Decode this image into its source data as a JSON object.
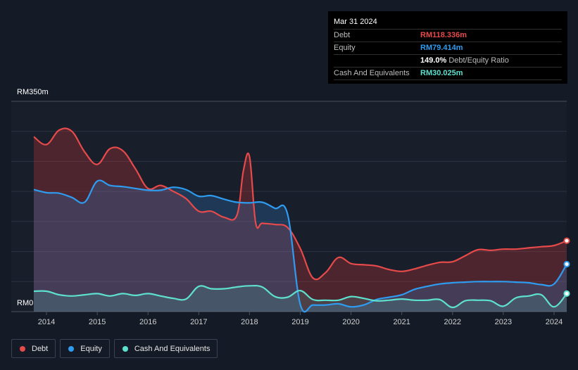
{
  "tooltip": {
    "date": "Mar 31 2024",
    "rows": [
      {
        "label": "Debt",
        "value": "RM118.336m",
        "color": "#e64a4a",
        "suffix": ""
      },
      {
        "label": "Equity",
        "value": "RM79.414m",
        "color": "#2e9cf0",
        "suffix": ""
      },
      {
        "label": "",
        "value": "149.0%",
        "color": "#ffffff",
        "suffix": "Debt/Equity Ratio"
      },
      {
        "label": "Cash And Equivalents",
        "value": "RM30.025m",
        "color": "#5ee0cf",
        "suffix": ""
      }
    ]
  },
  "legend": [
    {
      "label": "Debt",
      "color": "#e64a4a"
    },
    {
      "label": "Equity",
      "color": "#2e9cf0"
    },
    {
      "label": "Cash And Equivalents",
      "color": "#5ee0cf"
    }
  ],
  "chart_data": {
    "type": "area",
    "y_top_label": "RM350m",
    "y_bottom_label": "RM0",
    "ylim": [
      0,
      350
    ],
    "xlim": [
      2013.75,
      2024.25
    ],
    "x_ticks": [
      "2014",
      "2015",
      "2016",
      "2017",
      "2018",
      "2019",
      "2020",
      "2021",
      "2022",
      "2023",
      "2024"
    ],
    "grid": true,
    "series": [
      {
        "name": "Debt",
        "color": "#e64a4a",
        "x": [
          2013.75,
          2014.0,
          2014.25,
          2014.5,
          2014.75,
          2015.0,
          2015.25,
          2015.5,
          2015.75,
          2016.0,
          2016.25,
          2016.5,
          2016.75,
          2017.0,
          2017.25,
          2017.5,
          2017.75,
          2017.88,
          2018.0,
          2018.12,
          2018.25,
          2018.5,
          2018.75,
          2019.0,
          2019.25,
          2019.5,
          2019.75,
          2020.0,
          2020.25,
          2020.5,
          2020.75,
          2021.0,
          2021.25,
          2021.5,
          2021.75,
          2022.0,
          2022.25,
          2022.5,
          2022.75,
          2023.0,
          2023.25,
          2023.5,
          2023.75,
          2024.0,
          2024.25
        ],
        "values": [
          291,
          278,
          302,
          300,
          266,
          245,
          271,
          268,
          238,
          205,
          210,
          200,
          188,
          167,
          167,
          157,
          160,
          235,
          258,
          148,
          147,
          145,
          140,
          105,
          56,
          65,
          90,
          80,
          78,
          76,
          70,
          67,
          71,
          77,
          82,
          83,
          93,
          103,
          102,
          104,
          104,
          106,
          108,
          110,
          118
        ]
      },
      {
        "name": "Equity",
        "color": "#2e9cf0",
        "x": [
          2013.75,
          2014.0,
          2014.25,
          2014.5,
          2014.75,
          2015.0,
          2015.25,
          2015.5,
          2015.75,
          2016.0,
          2016.25,
          2016.5,
          2016.75,
          2017.0,
          2017.25,
          2017.5,
          2017.75,
          2018.0,
          2018.25,
          2018.5,
          2018.75,
          2019.0,
          2019.25,
          2019.5,
          2019.75,
          2020.0,
          2020.25,
          2020.5,
          2020.75,
          2021.0,
          2021.25,
          2021.5,
          2021.75,
          2022.0,
          2022.25,
          2022.5,
          2022.75,
          2023.0,
          2023.25,
          2023.5,
          2023.75,
          2024.0,
          2024.25
        ],
        "values": [
          203,
          198,
          197,
          190,
          182,
          217,
          210,
          208,
          205,
          202,
          202,
          207,
          203,
          192,
          193,
          187,
          182,
          181,
          182,
          172,
          162,
          12,
          11,
          11,
          13,
          8,
          11,
          20,
          24,
          28,
          37,
          42,
          46,
          48,
          49,
          50,
          50,
          50,
          49,
          48,
          45,
          46,
          79
        ]
      },
      {
        "name": "Cash And Equivalents",
        "color": "#5ee0cf",
        "x": [
          2013.75,
          2014.0,
          2014.25,
          2014.5,
          2014.75,
          2015.0,
          2015.25,
          2015.5,
          2015.75,
          2016.0,
          2016.25,
          2016.5,
          2016.75,
          2017.0,
          2017.25,
          2017.5,
          2017.75,
          2018.0,
          2018.25,
          2018.5,
          2018.75,
          2019.0,
          2019.25,
          2019.5,
          2019.75,
          2020.0,
          2020.25,
          2020.5,
          2020.75,
          2021.0,
          2021.25,
          2021.5,
          2021.75,
          2022.0,
          2022.25,
          2022.5,
          2022.75,
          2023.0,
          2023.25,
          2023.5,
          2023.75,
          2024.0,
          2024.25
        ],
        "values": [
          34,
          34,
          28,
          26,
          28,
          30,
          26,
          30,
          27,
          30,
          26,
          22,
          21,
          42,
          38,
          38,
          41,
          43,
          41,
          25,
          24,
          35,
          20,
          19,
          19,
          25,
          22,
          18,
          19,
          21,
          19,
          19,
          20,
          7,
          18,
          19,
          18,
          9,
          23,
          26,
          28,
          8,
          30
        ]
      }
    ]
  }
}
